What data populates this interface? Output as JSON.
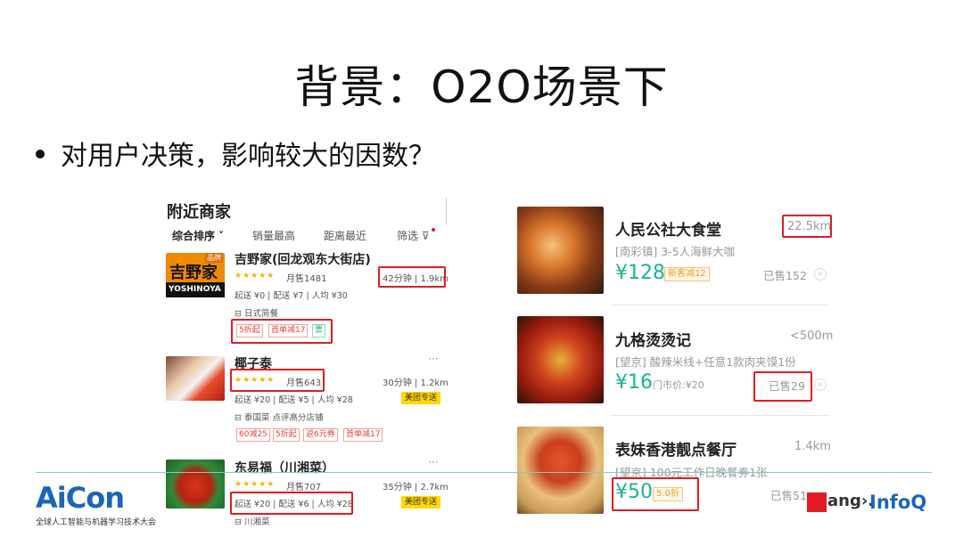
{
  "slide": {
    "title": "背景：O2O场景下",
    "bullet": "对用户决策，影响较大的因数？"
  },
  "left_panel": {
    "header": "附近商家",
    "sort_tabs": [
      "综合排序 ˅",
      "销量最高",
      "距离最近",
      "筛选 ⊽"
    ],
    "shops": [
      {
        "logo_text_top": "吉野家",
        "logo_badge": "品牌",
        "logo_text_bottom": "YOSHINOYA",
        "name": "吉野家(回龙观东大街店)",
        "stars": "★★★★★",
        "monthly_sales": "月售1481",
        "delivery_time_distance": "42分钟 | 1.9km",
        "fees": "起送 ¥0 | 配送 ¥7 | 人均 ¥30",
        "category": "日式简餐",
        "tags": [
          "5折起",
          "首单减17",
          "票"
        ]
      },
      {
        "name": "椰子泰",
        "stars": "★★★★★",
        "monthly_sales": "月售643",
        "delivery_time_distance": "30分钟 | 1.2km",
        "fees": "起送 ¥20 | 配送 ¥5 | 人均 ¥28",
        "delivery_badge": "美团专送",
        "category": "泰国菜  点评高分店铺",
        "tags": [
          "60减25",
          "5折起",
          "返6元券",
          "首单减17"
        ]
      },
      {
        "name": "东易福（川湘菜）",
        "stars": "★★★★★",
        "monthly_sales": "月售707",
        "delivery_time_distance": "35分钟 | 2.7km",
        "fees": "起送 ¥20 | 配送 ¥6 | 人均 ¥28",
        "delivery_badge": "美团专送",
        "category": "川湘菜"
      }
    ],
    "more_icon": "···"
  },
  "right_panel": {
    "items": [
      {
        "name": "人民公社大食堂",
        "distance": "22.5km",
        "sub": "[南彩镇] 3-5人海鲜大咖",
        "price": "¥128",
        "tag": "新客减12",
        "sold": "已售152"
      },
      {
        "name": "九格烫烫记",
        "distance": "<500m",
        "sub": "[望京] 酸辣米线+任意1款肉夹馍1份",
        "price": "¥16",
        "orig_price": "门市价:¥20",
        "sold": "已售29"
      },
      {
        "name": "表妹香港靓点餐厅",
        "distance": "1.4km",
        "sub": "[望京] 100元工作日晚餐券1张",
        "price": "¥50",
        "tag": "5.0折",
        "sold": "已售51"
      }
    ],
    "close_glyph": "×"
  },
  "footer": {
    "aicon": "AiCon",
    "aicon_sub": "全球人工智能与机器学习技术大会",
    "geek": "ang›.",
    "infoq": "InfoQ"
  },
  "colors": {
    "highlight": "#e21b23",
    "price_green": "#19b394",
    "star": "#f7b500",
    "brand_blue": "#1a66b8"
  }
}
